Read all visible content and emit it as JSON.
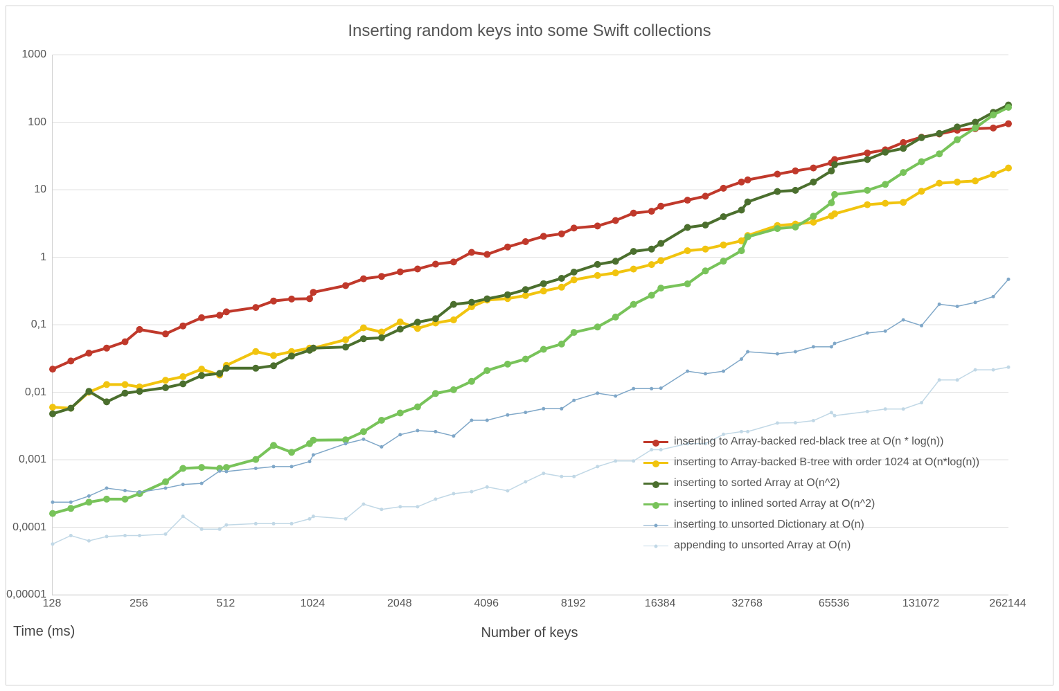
{
  "chart_data": {
    "type": "line",
    "title": "Inserting random keys into some Swift collections",
    "xlabel": "Number of keys",
    "ylabel": "Time (ms)",
    "x_scale": "log2",
    "y_scale": "log10",
    "xlim": [
      128,
      262144
    ],
    "ylim": [
      1e-05,
      1000
    ],
    "x_ticks": [
      128,
      256,
      512,
      1024,
      2048,
      4096,
      8192,
      16384,
      32768,
      65536,
      131072,
      262144
    ],
    "y_ticks": [
      1e-05,
      0.0001,
      0.001,
      0.01,
      0.1,
      1,
      10,
      100,
      1000
    ],
    "y_tick_labels": [
      "0,00001",
      "0,0001",
      "0,001",
      "0,01",
      "0,1",
      "1",
      "10",
      "100",
      "1000"
    ],
    "legend_position": "lower-right",
    "grid_y": true,
    "x": [
      128,
      148,
      171,
      197,
      228,
      256,
      315,
      362,
      420,
      485,
      512,
      647,
      746,
      861,
      994,
      1024,
      1325,
      1529,
      1765,
      2048,
      2352,
      2716,
      3135,
      3620,
      4096,
      4824,
      5568,
      6427,
      7420,
      8192,
      9886,
      11412,
      13173,
      15205,
      16384,
      20255,
      23380,
      26988,
      31153,
      32768,
      41506,
      47912,
      55307,
      63843,
      65536,
      85054,
      98180,
      113333,
      131072,
      151006,
      174312,
      201215,
      232270,
      262144
    ],
    "series": [
      {
        "name": "inserting to Array-backed red-black tree at O(n * log(n))",
        "color": "#c0392b",
        "thick": true,
        "values": [
          0.022,
          0.029,
          0.038,
          0.045,
          0.056,
          0.085,
          0.073,
          0.096,
          0.127,
          0.138,
          0.155,
          0.18,
          0.225,
          0.24,
          0.243,
          0.302,
          0.38,
          0.48,
          0.52,
          0.608,
          0.67,
          0.79,
          0.85,
          1.18,
          1.1,
          1.42,
          1.7,
          2.04,
          2.22,
          2.7,
          2.9,
          3.5,
          4.5,
          4.8,
          5.7,
          7.0,
          8.0,
          10.5,
          13.0,
          14.0,
          17.0,
          19.0,
          21.0,
          25.0,
          28.0,
          35.0,
          39.0,
          50.0,
          60.0,
          67.0,
          76.0,
          80.0,
          82.0,
          95.0
        ]
      },
      {
        "name": "inserting to Array-backed B-tree with order 1024 at O(n*log(n))",
        "color": "#f1c40f",
        "thick": true,
        "values": [
          0.006,
          0.0058,
          0.01,
          0.013,
          0.013,
          0.012,
          0.015,
          0.017,
          0.022,
          0.018,
          0.025,
          0.04,
          0.035,
          0.04,
          0.045,
          0.045,
          0.06,
          0.09,
          0.078,
          0.11,
          0.088,
          0.106,
          0.118,
          0.185,
          0.232,
          0.244,
          0.27,
          0.316,
          0.36,
          0.462,
          0.536,
          0.587,
          0.667,
          0.778,
          0.89,
          1.25,
          1.32,
          1.52,
          1.75,
          2.1,
          2.95,
          3.1,
          3.3,
          4.1,
          4.4,
          6.0,
          6.3,
          6.5,
          9.5,
          12.5,
          13.0,
          13.5,
          16.8,
          21.0
        ]
      },
      {
        "name": "inserting to sorted Array at O(n^2)",
        "color": "#4b6f2e",
        "thick": true,
        "values": [
          0.0048,
          0.0058,
          0.0103,
          0.0072,
          0.0097,
          0.0103,
          0.0117,
          0.0133,
          0.0177,
          0.019,
          0.0227,
          0.0227,
          0.0247,
          0.0343,
          0.0418,
          0.045,
          0.0467,
          0.062,
          0.064,
          0.086,
          0.109,
          0.123,
          0.2,
          0.215,
          0.242,
          0.278,
          0.331,
          0.406,
          0.487,
          0.602,
          0.783,
          0.87,
          1.22,
          1.32,
          1.6,
          2.76,
          3.0,
          3.98,
          5.0,
          6.6,
          9.4,
          9.8,
          13.0,
          19.0,
          23.5,
          28.0,
          36.0,
          41.0,
          59.0,
          68.0,
          85.0,
          100.0,
          140.0,
          180.0
        ]
      },
      {
        "name": "inserting to inlined sorted Array at O(n^2)",
        "color": "#78c35a",
        "thick": true,
        "values": [
          0.00016,
          0.00019,
          0.000235,
          0.000261,
          0.000261,
          0.000314,
          0.000471,
          0.000744,
          0.00077,
          0.000744,
          0.00077,
          0.00101,
          0.00163,
          0.00129,
          0.00173,
          0.00195,
          0.00197,
          0.00261,
          0.00384,
          0.00492,
          0.00607,
          0.00958,
          0.0109,
          0.0145,
          0.021,
          0.0261,
          0.031,
          0.0432,
          0.0518,
          0.077,
          0.0925,
          0.13,
          0.2,
          0.273,
          0.349,
          0.403,
          0.627,
          0.874,
          1.25,
          2.0,
          2.66,
          2.8,
          4.05,
          6.4,
          8.5,
          9.8,
          12.0,
          18.0,
          26.0,
          34.0,
          55.0,
          82.0,
          128.0,
          166.0
        ]
      },
      {
        "name": "inserting to unsorted Dictionary at O(n)",
        "color": "#7fa7c8",
        "thick": false,
        "values": [
          0.000235,
          0.000235,
          0.00029,
          0.00038,
          0.00035,
          0.00033,
          0.00038,
          0.00043,
          0.000447,
          0.00068,
          0.00067,
          0.000744,
          0.000792,
          0.000792,
          0.00094,
          0.00118,
          0.00173,
          0.00201,
          0.00155,
          0.00235,
          0.0027,
          0.00261,
          0.00225,
          0.00384,
          0.00384,
          0.00461,
          0.00503,
          0.0057,
          0.0057,
          0.00759,
          0.00968,
          0.00879,
          0.0113,
          0.0113,
          0.0115,
          0.0205,
          0.0188,
          0.0205,
          0.031,
          0.0398,
          0.0371,
          0.0398,
          0.0471,
          0.0471,
          0.0529,
          0.0754,
          0.0805,
          0.118,
          0.097,
          0.201,
          0.187,
          0.214,
          0.261,
          0.471
        ]
      },
      {
        "name": "appending to unsorted Array at O(n)",
        "color": "#c1d8e6",
        "thick": false,
        "values": [
          5.65e-05,
          7.54e-05,
          6.29e-05,
          7.29e-05,
          7.54e-05,
          7.54e-05,
          7.92e-05,
          0.000145,
          9.36e-05,
          9.36e-05,
          0.000108,
          0.000113,
          0.000113,
          0.000113,
          0.000133,
          0.000145,
          0.000133,
          0.00022,
          0.000184,
          0.000201,
          0.000201,
          0.000261,
          0.000314,
          0.000337,
          0.000395,
          0.000346,
          0.000471,
          0.000628,
          0.000565,
          0.000565,
          0.000792,
          0.000958,
          0.000958,
          0.00141,
          0.00141,
          0.00173,
          0.00173,
          0.00238,
          0.00261,
          0.00261,
          0.0035,
          0.00353,
          0.0038,
          0.005,
          0.0045,
          0.00518,
          0.00565,
          0.00565,
          0.007,
          0.0152,
          0.0152,
          0.0215,
          0.0215,
          0.0235
        ]
      }
    ]
  }
}
